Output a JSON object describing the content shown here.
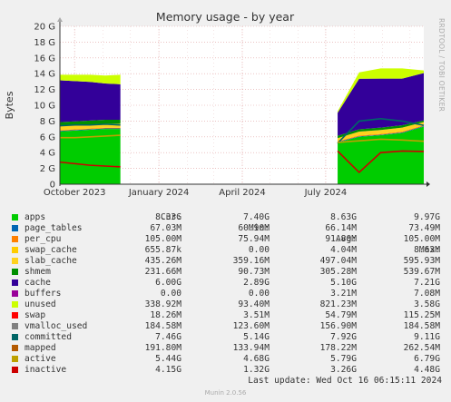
{
  "chart_data": {
    "type": "area",
    "title": "Memory usage - by year",
    "ylabel": "Bytes",
    "side_label": "RRDTOOL / TOBI OETIKER",
    "yticks": [
      "0",
      "2 G",
      "4 G",
      "6 G",
      "8 G",
      "10 G",
      "12 G",
      "14 G",
      "16 G",
      "18 G",
      "20 G"
    ],
    "ylim": [
      0,
      20
    ],
    "xticks": [
      {
        "label": "October 2023",
        "date": "2023-10-01"
      },
      {
        "label": "January 2024",
        "date": "2024-01-01"
      },
      {
        "label": "April 2024",
        "date": "2024-04-01"
      },
      {
        "label": "July 2024",
        "date": "2024-07-01"
      }
    ],
    "xlim": [
      "2023-09-15",
      "2024-10-16"
    ],
    "grid": true,
    "data_segments": [
      {
        "start": "2023-09-15",
        "end": "2023-11-20"
      },
      {
        "start": "2024-07-14",
        "end": "2024-10-16"
      }
    ],
    "stack_order": [
      "apps",
      "page_tables",
      "per_cpu",
      "swap_cache",
      "slab_cache",
      "shmem",
      "cache",
      "buffers",
      "unused"
    ],
    "line_series": [
      "swap",
      "vmalloc_used",
      "committed",
      "mapped",
      "active",
      "inactive"
    ],
    "series": [
      {
        "name": "apps",
        "color": "#00cc00",
        "cur": "8.33G",
        "min": "7.40G",
        "avg": "8.63G",
        "max": "9.97G"
      },
      {
        "name": "page_tables",
        "color": "#0066b3",
        "cur": "67.03M",
        "min": "60.90M",
        "avg": "66.14M",
        "max": "73.49M"
      },
      {
        "name": "per_cpu",
        "color": "#ff8000",
        "cur": "105.00M",
        "min": "75.94M",
        "avg": "91.80M",
        "max": "105.00M"
      },
      {
        "name": "swap_cache",
        "color": "#ffcc00",
        "cur": "655.87k",
        "min": "0.00",
        "avg": "4.04M",
        "max": "8.63M"
      },
      {
        "name": "slab_cache",
        "color": "#ffd21e",
        "cur": "435.26M",
        "min": "359.16M",
        "avg": "497.04M",
        "max": "595.93M"
      },
      {
        "name": "shmem",
        "color": "#008f00",
        "cur": "231.66M",
        "min": "90.73M",
        "avg": "305.28M",
        "max": "539.67M"
      },
      {
        "name": "cache",
        "color": "#330099",
        "cur": "6.00G",
        "min": "2.89G",
        "avg": "5.10G",
        "max": "7.21G"
      },
      {
        "name": "buffers",
        "color": "#990099",
        "cur": "0.00",
        "min": "0.00",
        "avg": "3.21M",
        "max": "7.08M"
      },
      {
        "name": "unused",
        "color": "#ccff00",
        "cur": "338.92M",
        "min": "93.40M",
        "avg": "821.23M",
        "max": "3.58G"
      },
      {
        "name": "swap",
        "color": "#ff0000",
        "cur": "18.26M",
        "min": "3.51M",
        "avg": "54.79M",
        "max": "115.25M"
      },
      {
        "name": "vmalloc_used",
        "color": "#808080",
        "cur": "184.58M",
        "min": "123.60M",
        "avg": "156.90M",
        "max": "184.58M"
      },
      {
        "name": "committed",
        "color": "#006666",
        "cur": "7.46G",
        "min": "5.14G",
        "avg": "7.92G",
        "max": "9.11G"
      },
      {
        "name": "mapped",
        "color": "#b35a00",
        "cur": "191.80M",
        "min": "133.94M",
        "avg": "178.22M",
        "max": "262.54M"
      },
      {
        "name": "active",
        "color": "#bda000",
        "cur": "5.44G",
        "min": "4.68G",
        "avg": "5.79G",
        "max": "6.79G"
      },
      {
        "name": "inactive",
        "color": "#cc0000",
        "cur": "4.15G",
        "min": "1.32G",
        "avg": "3.26G",
        "max": "4.48G"
      }
    ],
    "stack_values_gb": {
      "segment_1": [
        {
          "apps": 6.7,
          "page_tables": 0.07,
          "per_cpu": 0.09,
          "swap_cache": 0.0,
          "slab_cache": 0.5,
          "shmem": 0.5,
          "cache": 5.3,
          "buffers": 0.0,
          "unused": 0.7
        },
        {
          "apps": 6.8,
          "page_tables": 0.07,
          "per_cpu": 0.09,
          "swap_cache": 0.0,
          "slab_cache": 0.5,
          "shmem": 0.5,
          "cache": 5.1,
          "buffers": 0.0,
          "unused": 0.8
        },
        {
          "apps": 6.9,
          "page_tables": 0.07,
          "per_cpu": 0.09,
          "swap_cache": 0.0,
          "slab_cache": 0.5,
          "shmem": 0.5,
          "cache": 4.9,
          "buffers": 0.0,
          "unused": 0.9
        },
        {
          "apps": 7.0,
          "page_tables": 0.07,
          "per_cpu": 0.09,
          "swap_cache": 0.0,
          "slab_cache": 0.5,
          "shmem": 0.5,
          "cache": 4.6,
          "buffers": 0.0,
          "unused": 1.0
        },
        {
          "apps": 7.0,
          "page_tables": 0.07,
          "per_cpu": 0.09,
          "swap_cache": 0.0,
          "slab_cache": 0.5,
          "shmem": 0.5,
          "cache": 4.5,
          "buffers": 0.0,
          "unused": 1.2
        }
      ],
      "segment_2": [
        {
          "apps": 5.3,
          "page_tables": 0.06,
          "per_cpu": 0.08,
          "swap_cache": 0.0,
          "slab_cache": 0.4,
          "shmem": 0.3,
          "cache": 2.9,
          "buffers": 0.0,
          "unused": 0.2
        },
        {
          "apps": 6.0,
          "page_tables": 0.07,
          "per_cpu": 0.09,
          "swap_cache": 0.0,
          "slab_cache": 0.5,
          "shmem": 0.3,
          "cache": 6.4,
          "buffers": 0.0,
          "unused": 0.8
        },
        {
          "apps": 6.2,
          "page_tables": 0.07,
          "per_cpu": 0.1,
          "swap_cache": 0.0,
          "slab_cache": 0.5,
          "shmem": 0.3,
          "cache": 6.2,
          "buffers": 0.0,
          "unused": 1.3
        },
        {
          "apps": 6.5,
          "page_tables": 0.07,
          "per_cpu": 0.1,
          "swap_cache": 0.0,
          "slab_cache": 0.5,
          "shmem": 0.3,
          "cache": 5.9,
          "buffers": 0.0,
          "unused": 1.3
        },
        {
          "apps": 7.3,
          "page_tables": 0.07,
          "per_cpu": 0.105,
          "swap_cache": 0.0,
          "slab_cache": 0.4,
          "shmem": 0.2,
          "cache": 6.0,
          "buffers": 0.0,
          "unused": 0.34
        }
      ]
    }
  },
  "legend_header": {
    "cur": "Cur:",
    "min": "Min:",
    "avg": "Avg:",
    "max": "Max:"
  },
  "footer": {
    "last_update": "Last update: Wed Oct 16 06:15:11 2024",
    "munin": "Munin 2.0.56"
  }
}
